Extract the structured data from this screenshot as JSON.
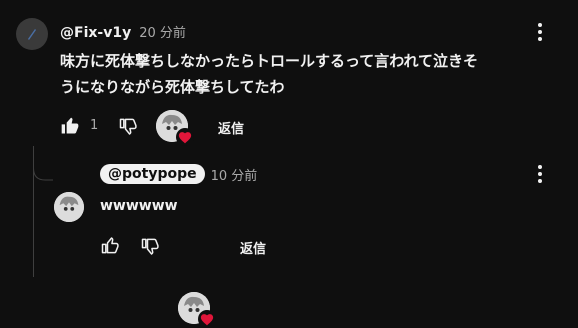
{
  "comment": {
    "author": "@Fix-v1y",
    "time": "20 分前",
    "text_line1": "味方に死体撃ちしなかったらトロールするって言われて泣きそ",
    "text_line2": "うになりながら死体撃ちしてたわ",
    "like_count": "1",
    "reply_label": "返信"
  },
  "reply": {
    "author": "@potypope",
    "time": "10 分前",
    "text": "wwwwww",
    "reply_label": "返信"
  },
  "colors": {
    "background": "#0f0f0f",
    "text": "#f1f1f1",
    "muted": "#aaaaaa",
    "heart": "#e0163a"
  }
}
